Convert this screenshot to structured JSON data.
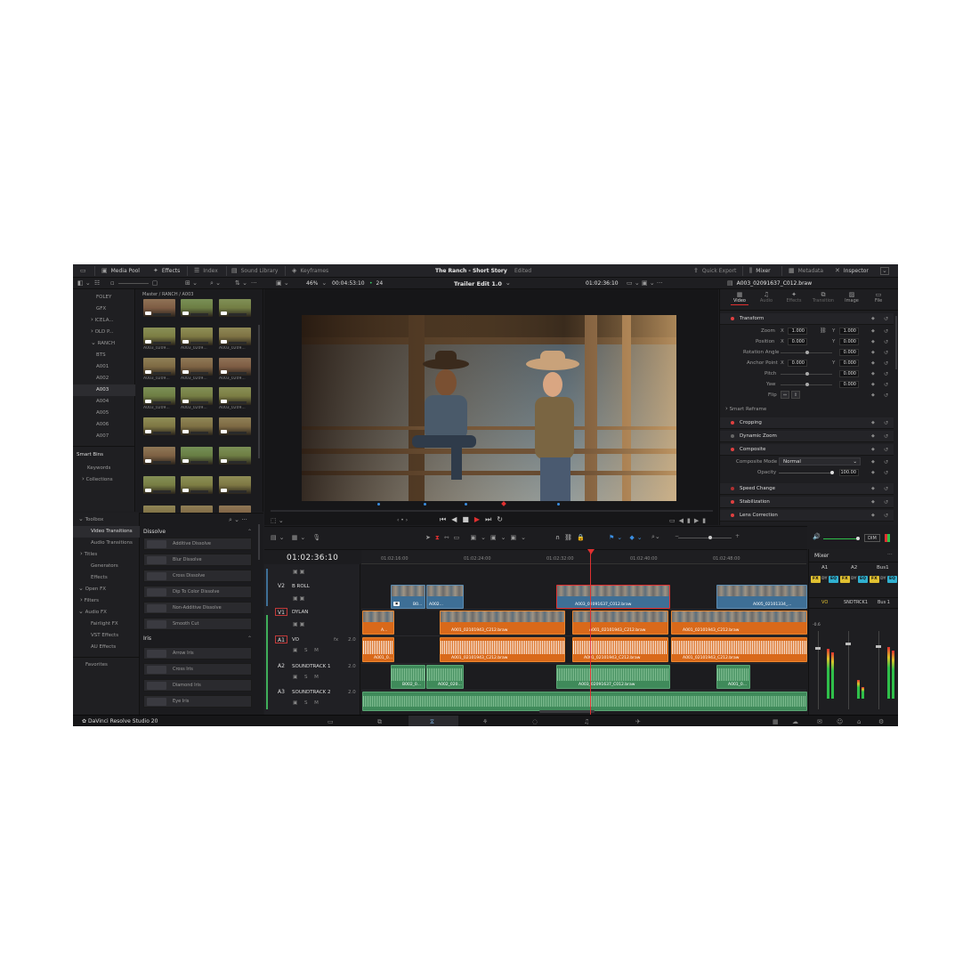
{
  "topbar": {
    "media_pool": "Media Pool",
    "effects": "Effects",
    "index": "Index",
    "sound_library": "Sound Library",
    "keyframes": "Keyframes",
    "project_title": "The Ranch - Short Story",
    "project_status": "Edited",
    "quick_export": "Quick Export",
    "mixer": "Mixer",
    "metadata": "Metadata",
    "inspector": "Inspector"
  },
  "viewer": {
    "zoom": "46%",
    "source_timecode": "00:04:53:10",
    "fps": "24",
    "timeline_name": "Trailer Edit 1.0",
    "record_timecode": "01:02:36:10"
  },
  "media_pool": {
    "breadcrumb": "Master / RANCH / A003",
    "bins": [
      "FOLEY",
      "GFX",
      "ICELA...",
      "OLD P...",
      "RANCH",
      "BTS",
      "A001",
      "A002",
      "A003",
      "A004",
      "A005",
      "A006",
      "A007"
    ],
    "selected_bin": "A003",
    "smart_bins": "Smart Bins",
    "smart_bin_items": [
      "Keywords",
      "Collections"
    ],
    "clip_label": "A003_0209..."
  },
  "effects_library": {
    "toolbox": "Toolbox",
    "items": [
      "Video Transitions",
      "Audio Transitions",
      "Titles",
      "Generators",
      "Effects",
      "Open FX",
      "Filters",
      "Audio FX",
      "Fairlight FX",
      "VST Effects",
      "AU Effects"
    ],
    "favorites": "Favorites",
    "dissolve_header": "Dissolve",
    "dissolve": [
      "Additive Dissolve",
      "Blur Dissolve",
      "Cross Dissolve",
      "Dip To Color Dissolve",
      "Non-Additive Dissolve",
      "Smooth Cut"
    ],
    "iris_header": "Iris",
    "iris": [
      "Arrow Iris",
      "Cross Iris",
      "Diamond Iris",
      "Eye Iris"
    ]
  },
  "inspector": {
    "clip_name": "A003_02091637_C012.braw",
    "tabs": [
      "Video",
      "Audio",
      "Effects",
      "Transition",
      "Image",
      "File"
    ],
    "transform": "Transform",
    "zoom_label": "Zoom",
    "zoom_x": "1.000",
    "zoom_y": "1.000",
    "position_label": "Position",
    "position_x": "0.000",
    "position_y": "0.000",
    "rotation_label": "Rotation Angle",
    "rotation": "0.000",
    "anchor_label": "Anchor Point",
    "anchor_x": "0.000",
    "anchor_y": "0.000",
    "pitch_label": "Pitch",
    "pitch": "0.000",
    "yaw_label": "Yaw",
    "yaw": "0.000",
    "flip_label": "Flip",
    "x": "X",
    "y": "Y",
    "smart_reframe": "Smart Reframe",
    "cropping": "Cropping",
    "dynamic_zoom": "Dynamic Zoom",
    "composite": "Composite",
    "composite_mode_label": "Composite Mode",
    "composite_mode": "Normal",
    "opacity_label": "Opacity",
    "opacity": "100.00",
    "speed_change": "Speed Change",
    "stabilization": "Stabilization",
    "lens_correction": "Lens Correction"
  },
  "timeline": {
    "timecode": "01:02:36:10",
    "ruler": [
      "01:02:16:00",
      "01:02:24:00",
      "01:02:32:00",
      "01:02:40:00",
      "01:02:48:00"
    ],
    "tracks": {
      "v2": {
        "num": "V2",
        "name": "B ROLL"
      },
      "v1": {
        "num": "V1",
        "name": "DYLAN"
      },
      "a1": {
        "num": "A1",
        "name": "VO",
        "ch": "2.0"
      },
      "a2": {
        "num": "A2",
        "name": "SOUNDTRACK 1",
        "ch": "2.0"
      },
      "a3": {
        "num": "A3",
        "name": "SOUNDTRACK 2",
        "ch": "2.0"
      }
    },
    "clips": {
      "broll1": "B0...",
      "broll2": "A002...",
      "broll_sel": "A003_02091637_C012.braw",
      "broll4": "A005_02101334_...",
      "dylan1": "A...",
      "dylan2": "A001_02101943_C212.braw",
      "dylan3": "A001_02101943_C212.braw",
      "dylan4": "A001_02101943_C212.braw",
      "vo1": "A001_0...",
      "vo2": "A001_02101943_C212.braw",
      "vo3": "A001_02101943_C212.braw",
      "vo4": "A001_02101943_C212.braw",
      "st1": "B002_0...",
      "st2": "A002_020...",
      "st3": "A003_02091637_C012.braw",
      "st4": "A001_0..."
    }
  },
  "mixer": {
    "title": "Mixer",
    "channels": [
      "A1",
      "A2",
      "Bus1"
    ],
    "routes": [
      "VO",
      "SNDTRCK1",
      "Bus 1"
    ],
    "fx": [
      "FX",
      "DY",
      "EQ"
    ],
    "db": "-0.6",
    "dim": "DIM"
  },
  "footer": {
    "app_name": "DaVinci Resolve Studio 20"
  },
  "colors": {
    "accent_red": "#e03030",
    "video_clip": "#3e6f96",
    "audio_clip": "#d9691a",
    "music_clip": "#3f8a5a"
  }
}
